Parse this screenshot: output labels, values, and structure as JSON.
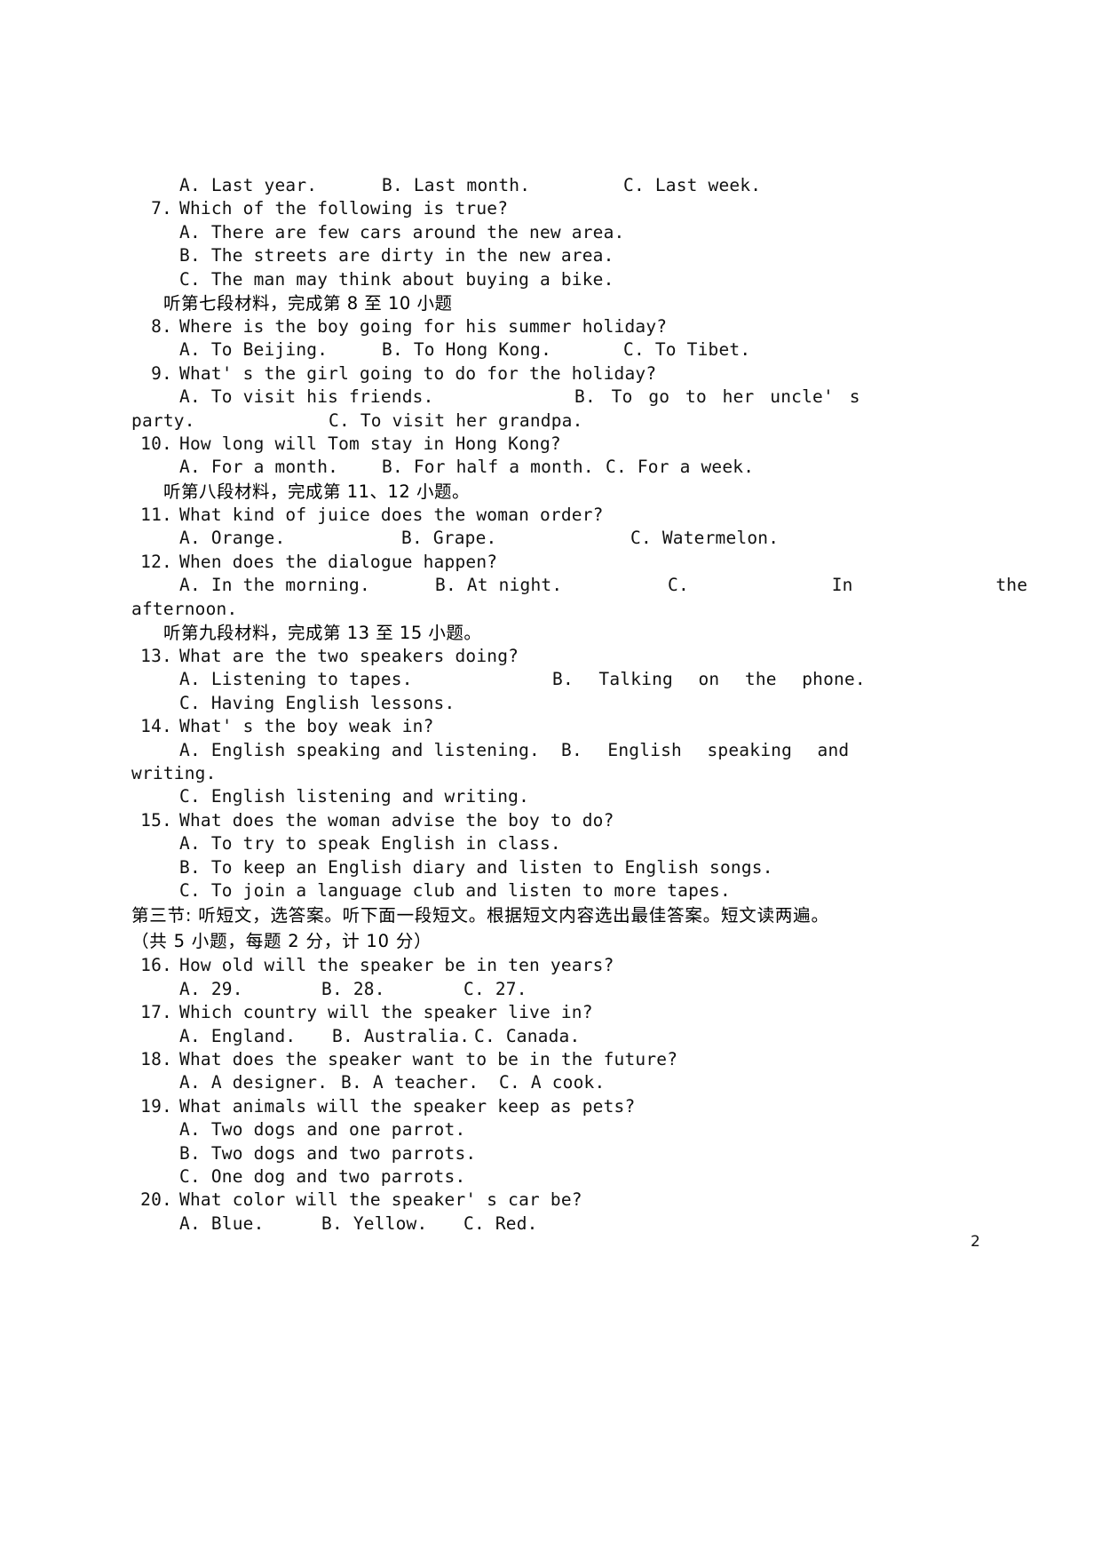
{
  "document": {
    "page_number": "2",
    "blocks": [
      {
        "id": "q6-options",
        "kind": "options3",
        "a": "A. Last year.",
        "b": "B. Last month.",
        "c": "C. Last week."
      },
      {
        "id": "q7",
        "kind": "question",
        "number": "7.",
        "text": "Which of the following is true?"
      },
      {
        "id": "q7a",
        "kind": "option-single",
        "text": "A. There are few cars around the new area."
      },
      {
        "id": "q7b",
        "kind": "option-single",
        "text": "B. The streets are dirty in the new area."
      },
      {
        "id": "q7c",
        "kind": "option-single",
        "text": "C. The man may think about buying a bike."
      },
      {
        "id": "section-seven-heading",
        "kind": "cn-heading",
        "text": "听第七段材料，完成第 8 至 10 小题"
      },
      {
        "id": "q8",
        "kind": "question",
        "number": "8.",
        "text": "Where is the boy going for his summer holiday?"
      },
      {
        "id": "q8-options",
        "kind": "options3",
        "a": "A. To Beijing.",
        "b": "B. To Hong Kong.",
        "c": "C. To Tibet."
      },
      {
        "id": "q9",
        "kind": "question",
        "number": "9.",
        "text": "What' s the girl going to do for the holiday?"
      },
      {
        "id": "q9-options",
        "kind": "justified-pair",
        "left": "A. To visit his friends.",
        "right": "B. To go to her uncle' s"
      },
      {
        "id": "q9-continuation",
        "kind": "continuation-pair",
        "left": "party.",
        "right": "C. To visit her grandpa."
      },
      {
        "id": "q10",
        "kind": "question",
        "number": "10.",
        "text": "How long will Tom stay in Hong Kong?"
      },
      {
        "id": "q10-options",
        "kind": "options3",
        "a": "A. For a month.",
        "b": "B. For half a month.",
        "c": "C. For a week."
      },
      {
        "id": "section-eight-heading",
        "kind": "cn-heading",
        "text": "听第八段材料，完成第 11、12 小题。"
      },
      {
        "id": "q11",
        "kind": "question",
        "number": "11.",
        "text": "What kind of juice does the woman order?"
      },
      {
        "id": "q11-options",
        "kind": "options3",
        "a": "A. Orange.",
        "b": "B. Grape.",
        "c": "C. Watermelon."
      },
      {
        "id": "q12",
        "kind": "question",
        "number": "12.",
        "text": "When does the dialogue happen?"
      },
      {
        "id": "q12-options",
        "kind": "justified-triple",
        "a": "A. In the morning.",
        "b": "B. At night.",
        "c": "C.    In    the"
      },
      {
        "id": "q12-continuation",
        "kind": "continuation-single",
        "text": "afternoon."
      },
      {
        "id": "section-nine-heading",
        "kind": "cn-heading",
        "text": "听第九段材料，完成第 13 至 15 小题。"
      },
      {
        "id": "q13",
        "kind": "question",
        "number": "13.",
        "text": "What are the two speakers doing?"
      },
      {
        "id": "q13-options",
        "kind": "justified-pair",
        "left": "A. Listening to tapes.",
        "right": "B. Talking on the phone."
      },
      {
        "id": "q13c",
        "kind": "option-single",
        "text": "C. Having English lessons."
      },
      {
        "id": "q14",
        "kind": "question",
        "number": "14.",
        "text": "What' s the boy weak in?"
      },
      {
        "id": "q14-options",
        "kind": "justified-pair",
        "left": "A. English speaking and listening.",
        "right": "B. English speaking and"
      },
      {
        "id": "q14-continuation",
        "kind": "continuation-single",
        "text": "writing."
      },
      {
        "id": "q14c",
        "kind": "option-single",
        "text": "C. English listening and writing."
      },
      {
        "id": "q15",
        "kind": "question",
        "number": "15.",
        "text": "What does the woman advise the boy to do?"
      },
      {
        "id": "q15a",
        "kind": "option-single",
        "text": "A. To try to speak English in class."
      },
      {
        "id": "q15b",
        "kind": "option-single",
        "text": "B. To keep an English diary and listen to English songs."
      },
      {
        "id": "q15c",
        "kind": "option-single",
        "text": "C. To join a language club and listen to more tapes."
      },
      {
        "id": "section-three-heading",
        "kind": "cn-flush",
        "text": "第三节: 听短文，选答案。听下面一段短文。根据短文内容选出最佳答案。短文读两遍。"
      },
      {
        "id": "section-three-scoring",
        "kind": "cn-flush",
        "text": "（共 5 小题，每题 2 分，计 10 分）"
      },
      {
        "id": "q16",
        "kind": "question",
        "number": "16.",
        "text": "How old will the speaker be in ten years?"
      },
      {
        "id": "q16-options",
        "kind": "options3-narrow",
        "a": "A. 29.",
        "b": "B. 28.",
        "c": "C. 27."
      },
      {
        "id": "q17",
        "kind": "question",
        "number": "17.",
        "text": "Which country will the speaker live in?"
      },
      {
        "id": "q17-options",
        "kind": "options3-narrow",
        "a": "A. England.",
        "b": "B. Australia.",
        "c": "C. Canada."
      },
      {
        "id": "q18",
        "kind": "question",
        "number": "18.",
        "text": "What does the speaker want to be in the future?"
      },
      {
        "id": "q18-options",
        "kind": "options3-narrow",
        "a": "A. A designer.",
        "b": "B. A teacher.",
        "c": "C. A cook."
      },
      {
        "id": "q19",
        "kind": "question",
        "number": "19.",
        "text": "What animals will the speaker keep as pets?"
      },
      {
        "id": "q19a",
        "kind": "option-single",
        "text": "A. Two dogs and one parrot."
      },
      {
        "id": "q19b",
        "kind": "option-single",
        "text": "B. Two dogs and two parrots."
      },
      {
        "id": "q19c",
        "kind": "option-single",
        "text": "C. One dog and two parrots."
      },
      {
        "id": "q20",
        "kind": "question",
        "number": "20.",
        "text": "What color will the speaker' s car be?"
      },
      {
        "id": "q20-options",
        "kind": "options3-narrow",
        "a": "A. Blue.",
        "b": "B. Yellow.",
        "c": "C. Red."
      }
    ]
  }
}
